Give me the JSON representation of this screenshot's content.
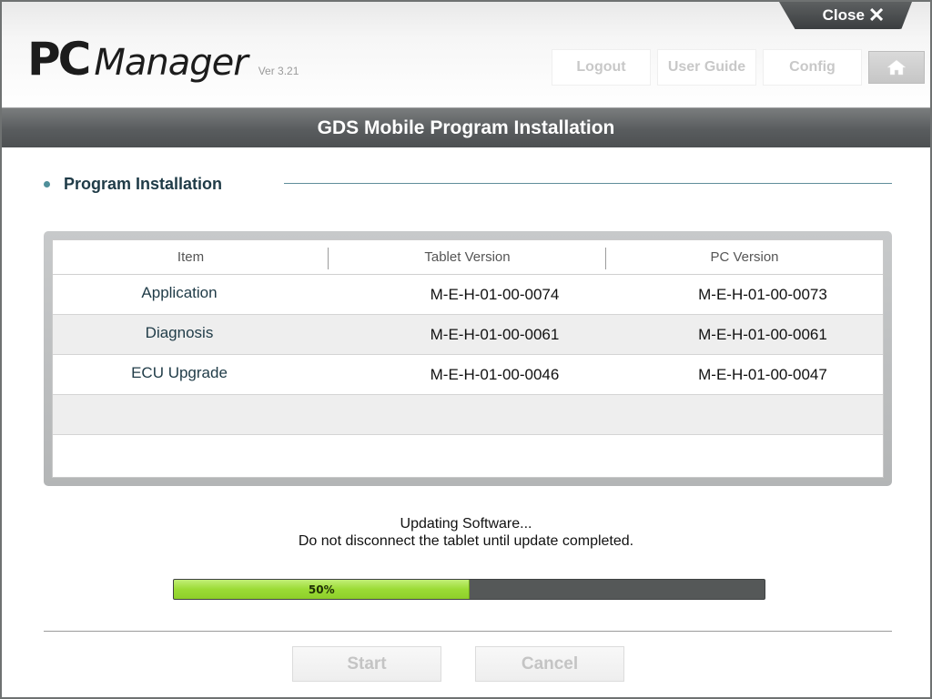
{
  "header": {
    "logo_pc": "PC",
    "logo_manager": "Manager",
    "version": "Ver 3.21",
    "close_label": "Close",
    "nav": {
      "logout": "Logout",
      "user_guide": "User Guide",
      "config": "Config"
    }
  },
  "title": "GDS Mobile Program Installation",
  "section": {
    "title": "Program Installation"
  },
  "table": {
    "columns": [
      "Item",
      "Tablet Version",
      "PC Version"
    ],
    "rows": [
      {
        "item": "Application",
        "tablet": "M-E-H-01-00-0074",
        "pc": "M-E-H-01-00-0073"
      },
      {
        "item": "Diagnosis",
        "tablet": "M-E-H-01-00-0061",
        "pc": "M-E-H-01-00-0061"
      },
      {
        "item": "ECU Upgrade",
        "tablet": "M-E-H-01-00-0046",
        "pc": "M-E-H-01-00-0047"
      },
      {
        "item": "",
        "tablet": "",
        "pc": ""
      },
      {
        "item": "",
        "tablet": "",
        "pc": ""
      }
    ]
  },
  "status": {
    "line1": "Updating Software...",
    "line2": "Do not disconnect the tablet until update completed."
  },
  "progress": {
    "value": 0.5,
    "label": "50%"
  },
  "actions": {
    "start": "Start",
    "cancel": "Cancel"
  },
  "colors": {
    "title_bar": "#595c5e",
    "progress_fill": "#9bdb35",
    "progress_track": "#555858",
    "accent": "#4f8f9a"
  },
  "icons": {
    "close": "close-x-icon",
    "home": "home-icon"
  }
}
